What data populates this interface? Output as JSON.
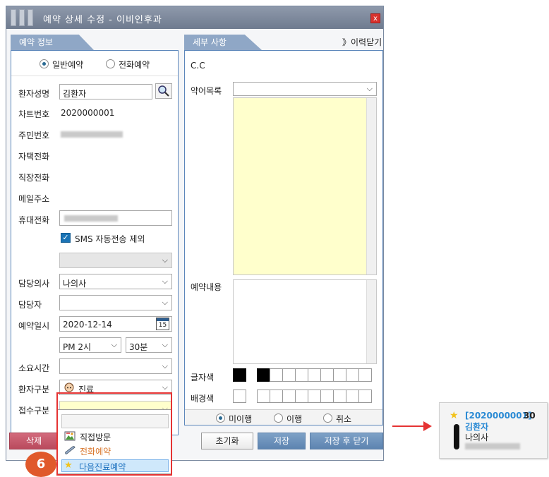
{
  "dialog": {
    "title": "예약 상세 수정 - 이비인후과",
    "close_glyph": "x",
    "history_link": "》이력닫기"
  },
  "left_panel": {
    "tab_label": "예약 정보",
    "reservation_type": {
      "option1": "일반예약",
      "option2": "전화예약",
      "selected": "일반예약"
    },
    "patient_name_label": "환자성명",
    "patient_name_value": "김환자",
    "chart_no_label": "차트번호",
    "chart_no_value": "2020000001",
    "resident_no_label": "주민번호",
    "home_phone_label": "자택전화",
    "work_phone_label": "직장전화",
    "email_label": "메일주소",
    "mobile_label": "휴대전화",
    "sms_exclude_label": "SMS 자동전송 제외",
    "doctor_label": "담당의사",
    "doctor_value": "나의사",
    "staff_label": "담당자",
    "datetime_label": "예약일시",
    "date_value": "2020-12-14",
    "calendar_day": "15",
    "hour_value": "PM 2시",
    "minute_value": "30분",
    "duration_label": "소요시간",
    "patient_type_label": "환자구분",
    "patient_type_value": "진료",
    "reception_type_label": "접수구분"
  },
  "dropdown": {
    "items": [
      "직접방문",
      "전화예약",
      "다음진료예약"
    ],
    "highlighted": "다음진료예약",
    "step_badge": "6"
  },
  "right_panel": {
    "tab_label": "세부 사항",
    "cc_label": "C.C",
    "abbrev_label": "약어목록",
    "content_label": "예약내용",
    "text_color_label": "글자색",
    "bg_color_label": "배경색",
    "status": {
      "option1": "미이행",
      "option2": "이행",
      "option3": "취소",
      "selected": "미이행"
    }
  },
  "buttons": {
    "delete": "삭제",
    "reset": "초기화",
    "save": "저장",
    "save_close": "저장 후 닫기"
  },
  "callout_card": {
    "chart_no": "[2020000001]",
    "number": "30",
    "patient_name": "김환자",
    "doctor": "나의사"
  },
  "colors": {
    "accent_blue": "#8fa7c6",
    "highlight_red": "#e53333",
    "badge_orange": "#e0592b",
    "card_blue": "#2a8ad4"
  }
}
